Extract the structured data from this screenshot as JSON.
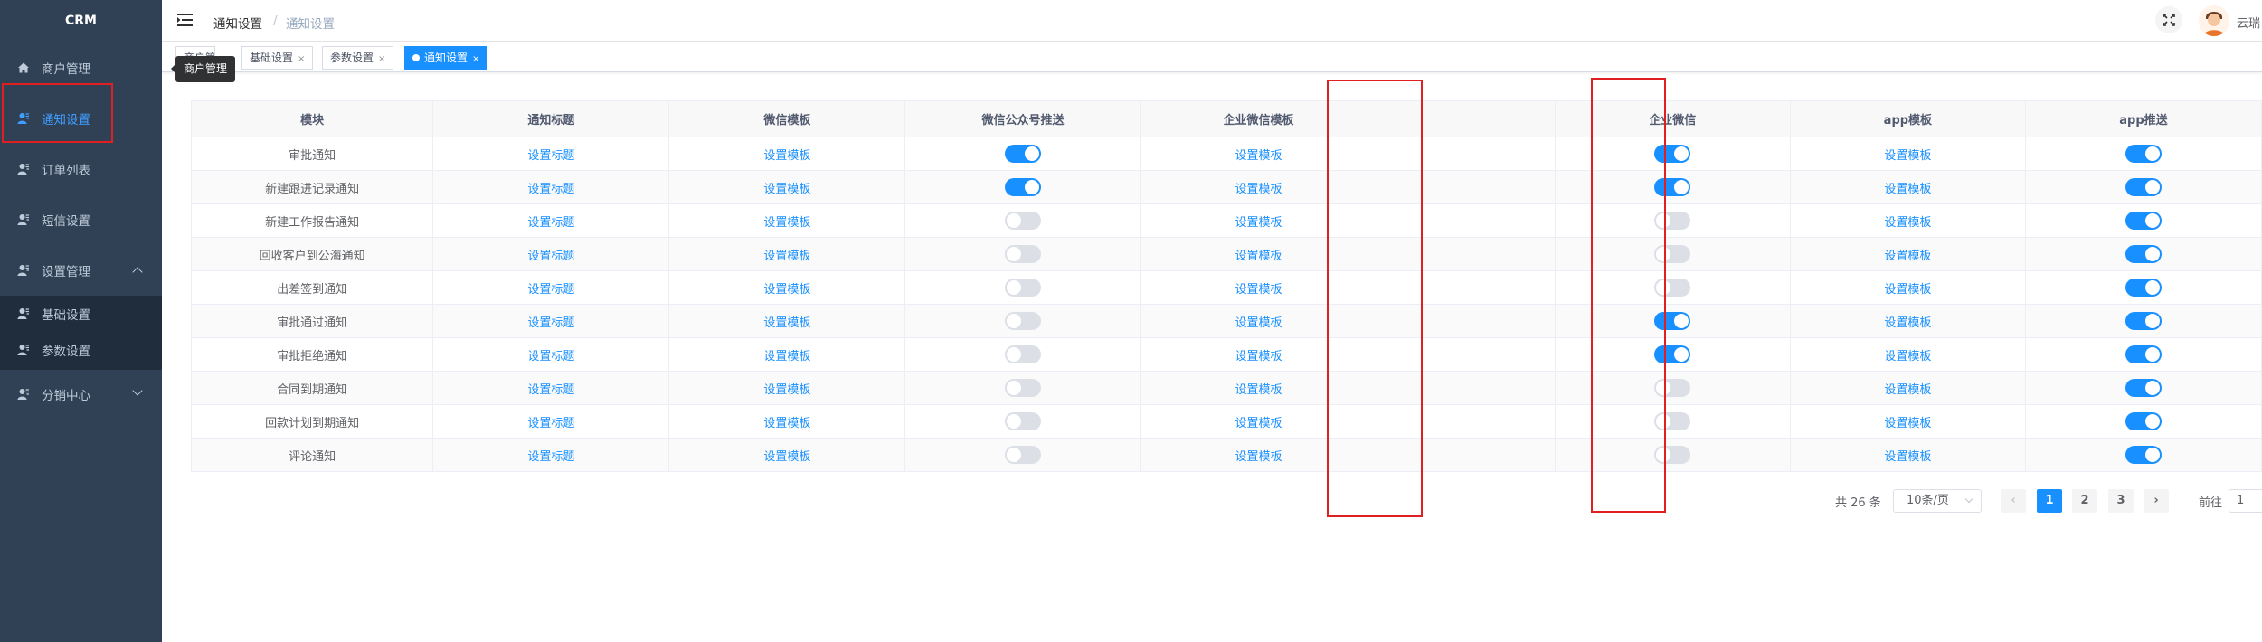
{
  "sidebar": {
    "logo": "CRM",
    "items": [
      {
        "label": "商户管理"
      },
      {
        "label": "通知设置"
      },
      {
        "label": "订单列表"
      },
      {
        "label": "短信设置"
      },
      {
        "label": "设置管理"
      },
      {
        "label": "基础设置"
      },
      {
        "label": "参数设置"
      },
      {
        "label": "分销中心"
      }
    ],
    "tooltip": "商户管理"
  },
  "navbar": {
    "breadcrumb": [
      "通知设置",
      "通知设置"
    ],
    "breadcrumb_sep": "/",
    "username": "云瑞"
  },
  "tags": [
    {
      "label": "商户管理"
    },
    {
      "label": "基础设置"
    },
    {
      "label": "参数设置"
    },
    {
      "label": "通知设置"
    }
  ],
  "table": {
    "headers": [
      "模块",
      "通知标题",
      "微信模板",
      "微信公众号推送",
      "企业微信模板",
      "",
      "企业微信",
      "app模板",
      "app推送"
    ],
    "set_title_label": "设置标题",
    "set_template_label": "设置模板",
    "rows": [
      {
        "module": "审批通知",
        "wx_push": true,
        "qy_wx": true,
        "app_push": true
      },
      {
        "module": "新建跟进记录通知",
        "wx_push": true,
        "qy_wx": true,
        "app_push": true
      },
      {
        "module": "新建工作报告通知",
        "wx_push": false,
        "qy_wx": false,
        "app_push": true
      },
      {
        "module": "回收客户到公海通知",
        "wx_push": false,
        "qy_wx": false,
        "app_push": true
      },
      {
        "module": "出差签到通知",
        "wx_push": false,
        "qy_wx": false,
        "app_push": true
      },
      {
        "module": "审批通过通知",
        "wx_push": false,
        "qy_wx": true,
        "app_push": true
      },
      {
        "module": "审批拒绝通知",
        "wx_push": false,
        "qy_wx": true,
        "app_push": true
      },
      {
        "module": "合同到期通知",
        "wx_push": false,
        "qy_wx": false,
        "app_push": true
      },
      {
        "module": "回款计划到期通知",
        "wx_push": false,
        "qy_wx": false,
        "app_push": true
      },
      {
        "module": "评论通知",
        "wx_push": false,
        "qy_wx": false,
        "app_push": true
      }
    ]
  },
  "pagination": {
    "total": "共 26 条",
    "page_size": "10条/页",
    "pages": [
      "1",
      "2",
      "3"
    ],
    "current": "1",
    "goto_label": "前往",
    "goto_value": "1"
  },
  "colors": {
    "primary": "#1890ff",
    "sidebar": "#304156",
    "highlight": "#e02020"
  }
}
